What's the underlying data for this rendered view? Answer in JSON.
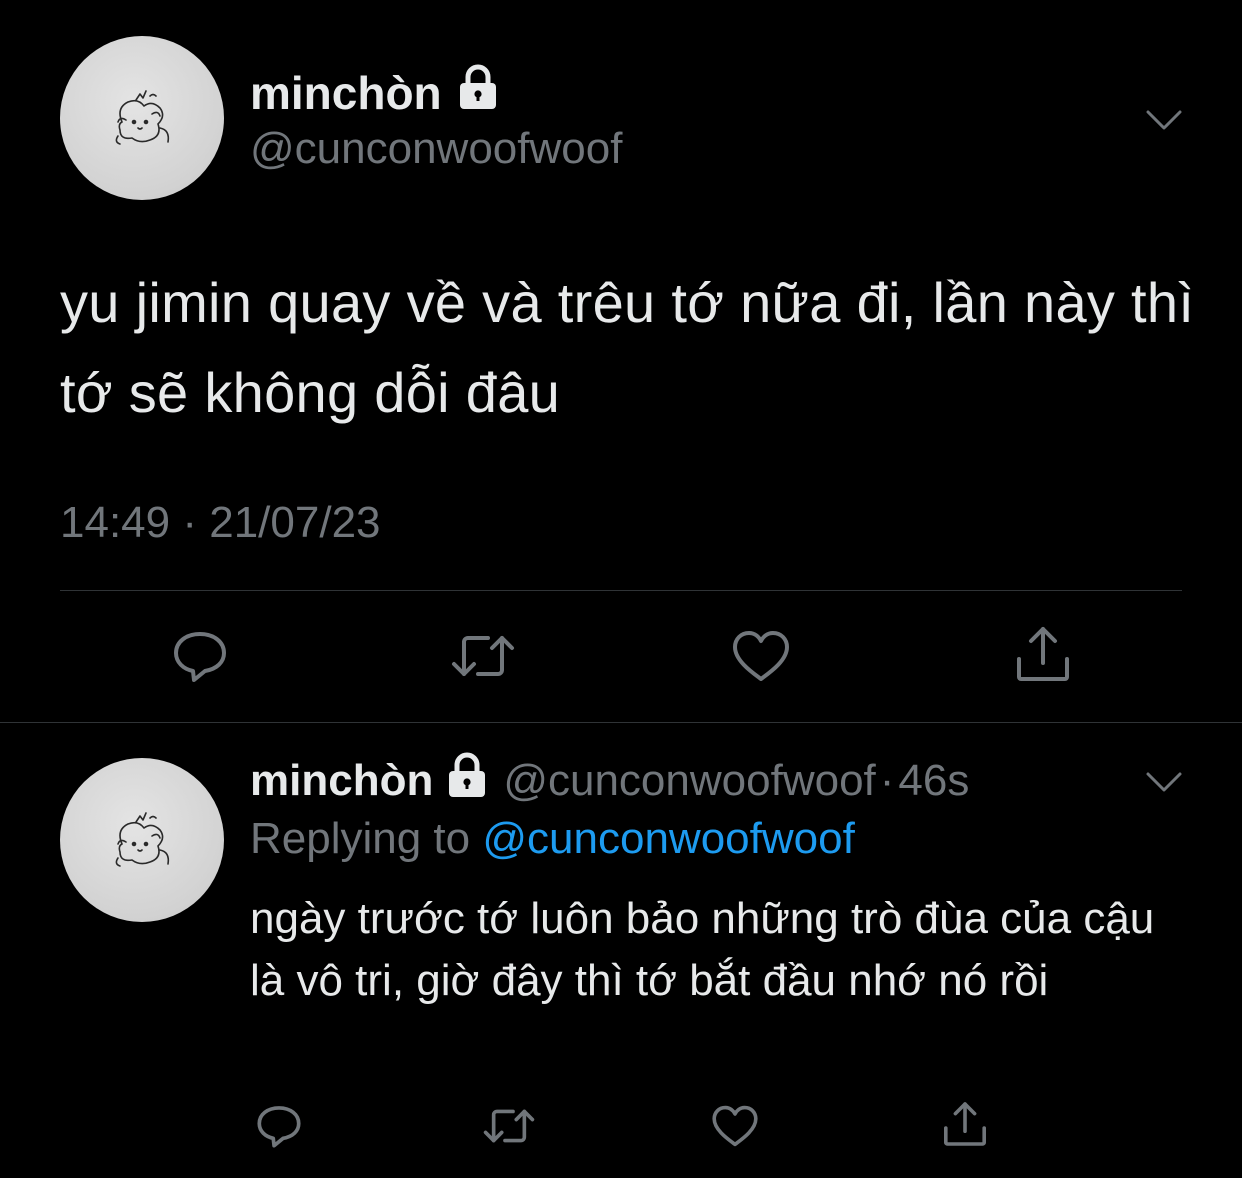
{
  "main_tweet": {
    "display_name": "minchòn",
    "handle": "@cuncon⁠woofwoof",
    "text": "yu jimin quay về và trêu tớ nữa đi, lần này thì tớ sẽ không dỗi đâu",
    "time": "14:49",
    "separator": "·",
    "date": "21/07/23",
    "icons": {
      "lock": "lock-icon",
      "menu": "chevron-down-icon",
      "reply": "reply-bubble-icon",
      "retweet": "retweet-icon",
      "like": "heart-icon",
      "share": "share-icon"
    }
  },
  "reply_tweet": {
    "display_name": "minchòn",
    "handle": "@cunconwoofwoof",
    "dot": "·",
    "age": "46s",
    "replying_prefix": "Replying to",
    "replying_handle": "@cunconwoofwoof",
    "text": "ngày trước tớ luôn bảo những trò đùa của cậu là vô tri, giờ đây thì tớ bắt đầu nhớ nó rồi"
  },
  "colors": {
    "background": "#000000",
    "primary_text": "#e7e9ea",
    "secondary_text": "#71767b",
    "link": "#1d9bf0",
    "divider": "#2f3336"
  }
}
